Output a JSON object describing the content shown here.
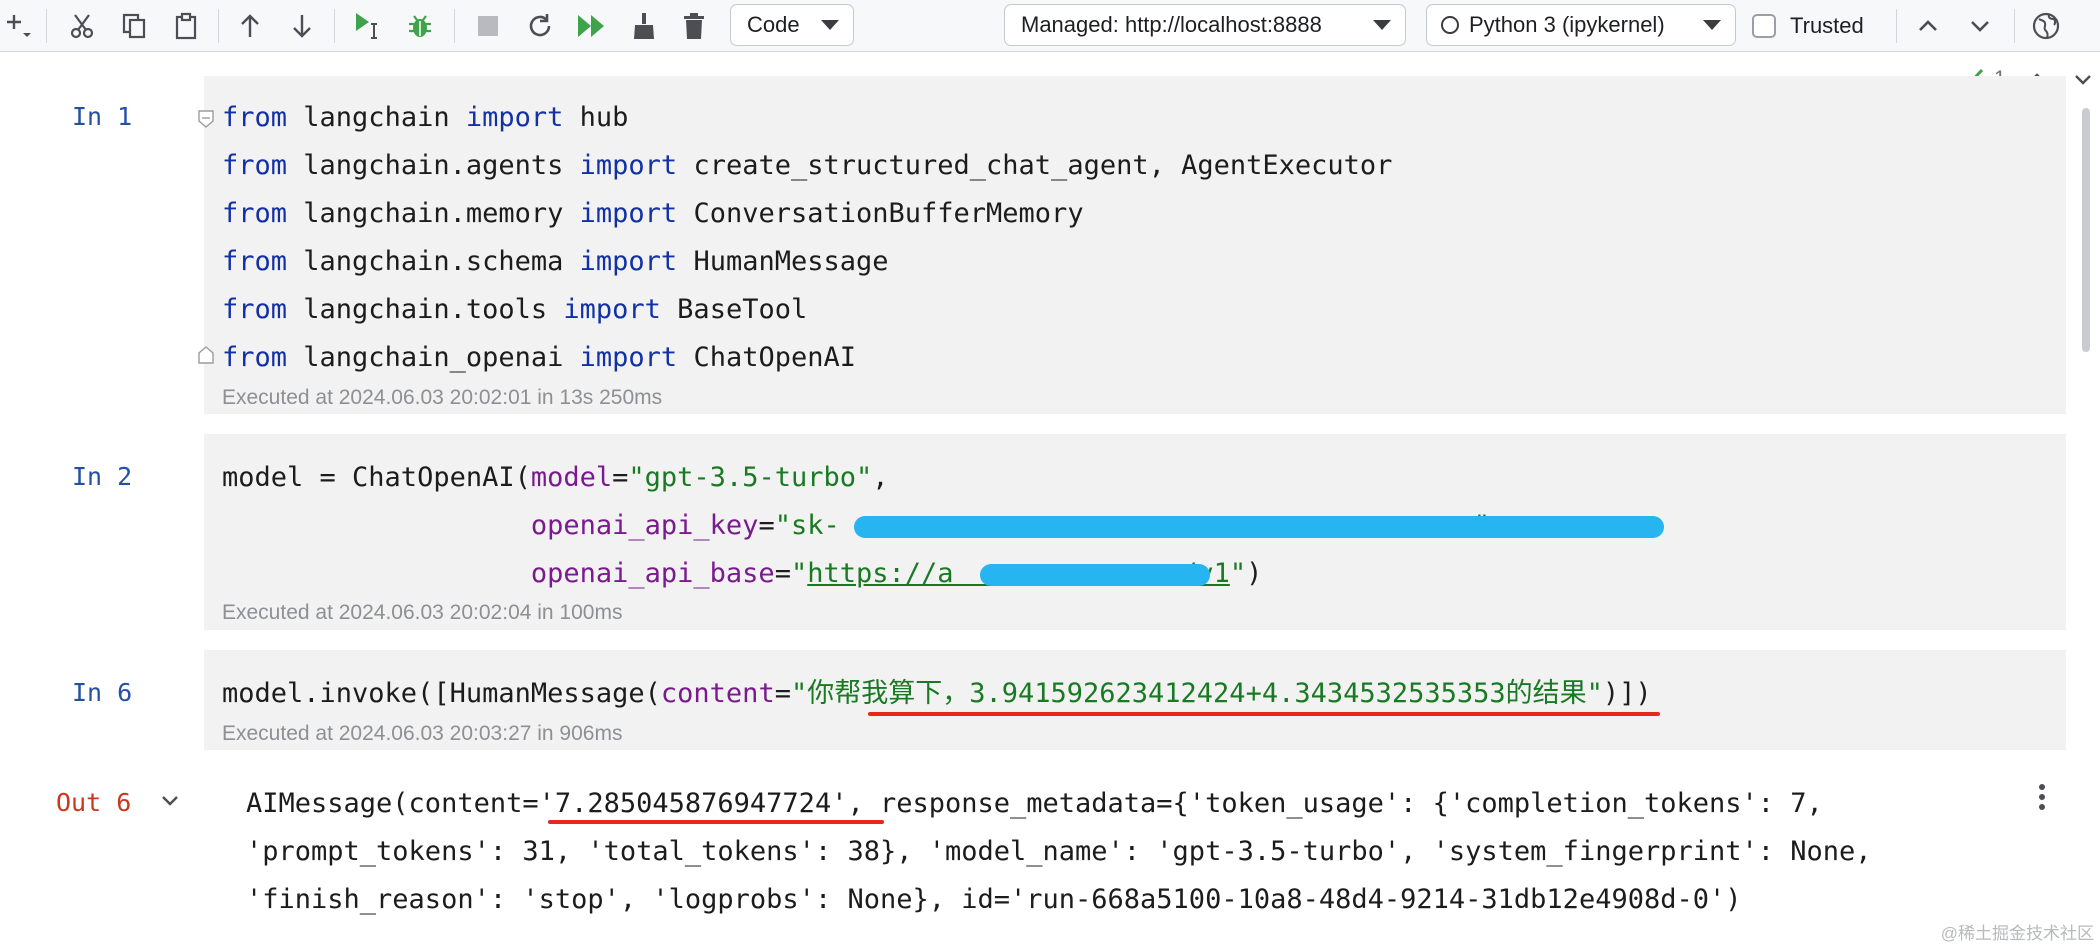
{
  "toolbar": {
    "cell_type": "Code",
    "server": "Managed: http://localhost:8888",
    "kernel": "Python 3 (ipykernel)",
    "trusted_label": "Trusted",
    "icons": [
      "add-cell-icon",
      "cut-icon",
      "copy-icon",
      "paste-icon",
      "move-up-icon",
      "move-down-icon",
      "run-cell-icon",
      "debug-icon",
      "stop-icon",
      "restart-icon",
      "run-all-icon",
      "clear-icon",
      "delete-icon",
      "chevron-up-icon",
      "chevron-down-icon",
      "globe-icon"
    ]
  },
  "inspection": {
    "count": "1"
  },
  "cells": [
    {
      "prompt": "In 1",
      "lines": [
        [
          "kw:from",
          " langchain ",
          "kw:import",
          " hub"
        ],
        [
          "kw:from",
          " langchain.agents ",
          "kw:import",
          " create_structured_chat_agent, AgentExecutor"
        ],
        [
          "kw:from",
          " langchain.memory ",
          "kw:import",
          " ConversationBufferMemory"
        ],
        [
          "kw:from",
          " langchain.schema ",
          "kw:import",
          " HumanMessage"
        ],
        [
          "kw:from",
          " langchain.tools ",
          "kw:import",
          " BaseTool"
        ],
        [
          "kw:from",
          " langchain_openai ",
          "kw:import",
          " ChatOpenAI"
        ]
      ],
      "exec": "Executed at 2024.06.03 20:02:01 in 13s 250ms"
    },
    {
      "prompt": "In 2",
      "lines": [
        [
          "model = ChatOpenAI(",
          "param:model",
          "=",
          "str:\"gpt-3.5-turbo\"",
          ","
        ],
        [
          "                   ",
          "param:openai_api_key",
          "=",
          "str:\"sk-",
          "str:                                       ",
          "str:\"",
          ","
        ],
        [
          "                   ",
          "param:openai_api_base",
          "=",
          "str:\"",
          "url:https://a             m/v1",
          "str:\"",
          ")"
        ]
      ],
      "exec": "Executed at 2024.06.03 20:02:04 in 100ms"
    },
    {
      "prompt": "In 6",
      "lines": [
        [
          "model.invoke([HumanMessage(",
          "param:content",
          "=",
          "str:\"你帮我算下，3.941592623412424+4.3434532535353的结果\"",
          ")])"
        ]
      ],
      "exec": "Executed at 2024.06.03 20:03:27 in 906ms"
    }
  ],
  "output": {
    "prompt": "Out 6",
    "lines": [
      "AIMessage(content='7.285045876947724', response_metadata={'token_usage': {'completion_tokens': 7,",
      "'prompt_tokens': 31, 'total_tokens': 38}, 'model_name': 'gpt-3.5-turbo', 'system_fingerprint': None,",
      "'finish_reason': 'stop', 'logprobs': None}, id='run-668a5100-10a8-48d4-9214-31db12e4908d-0')"
    ]
  },
  "watermark": "@稀土掘金技术社区",
  "colors": {
    "keyword": "#1231a5",
    "param": "#7a1a8e",
    "string": "#1a7a23",
    "prompt_in": "#2450a7",
    "prompt_out": "#c8381c",
    "annotation_red": "#e8271c",
    "redaction_blue": "#27b5f2"
  }
}
